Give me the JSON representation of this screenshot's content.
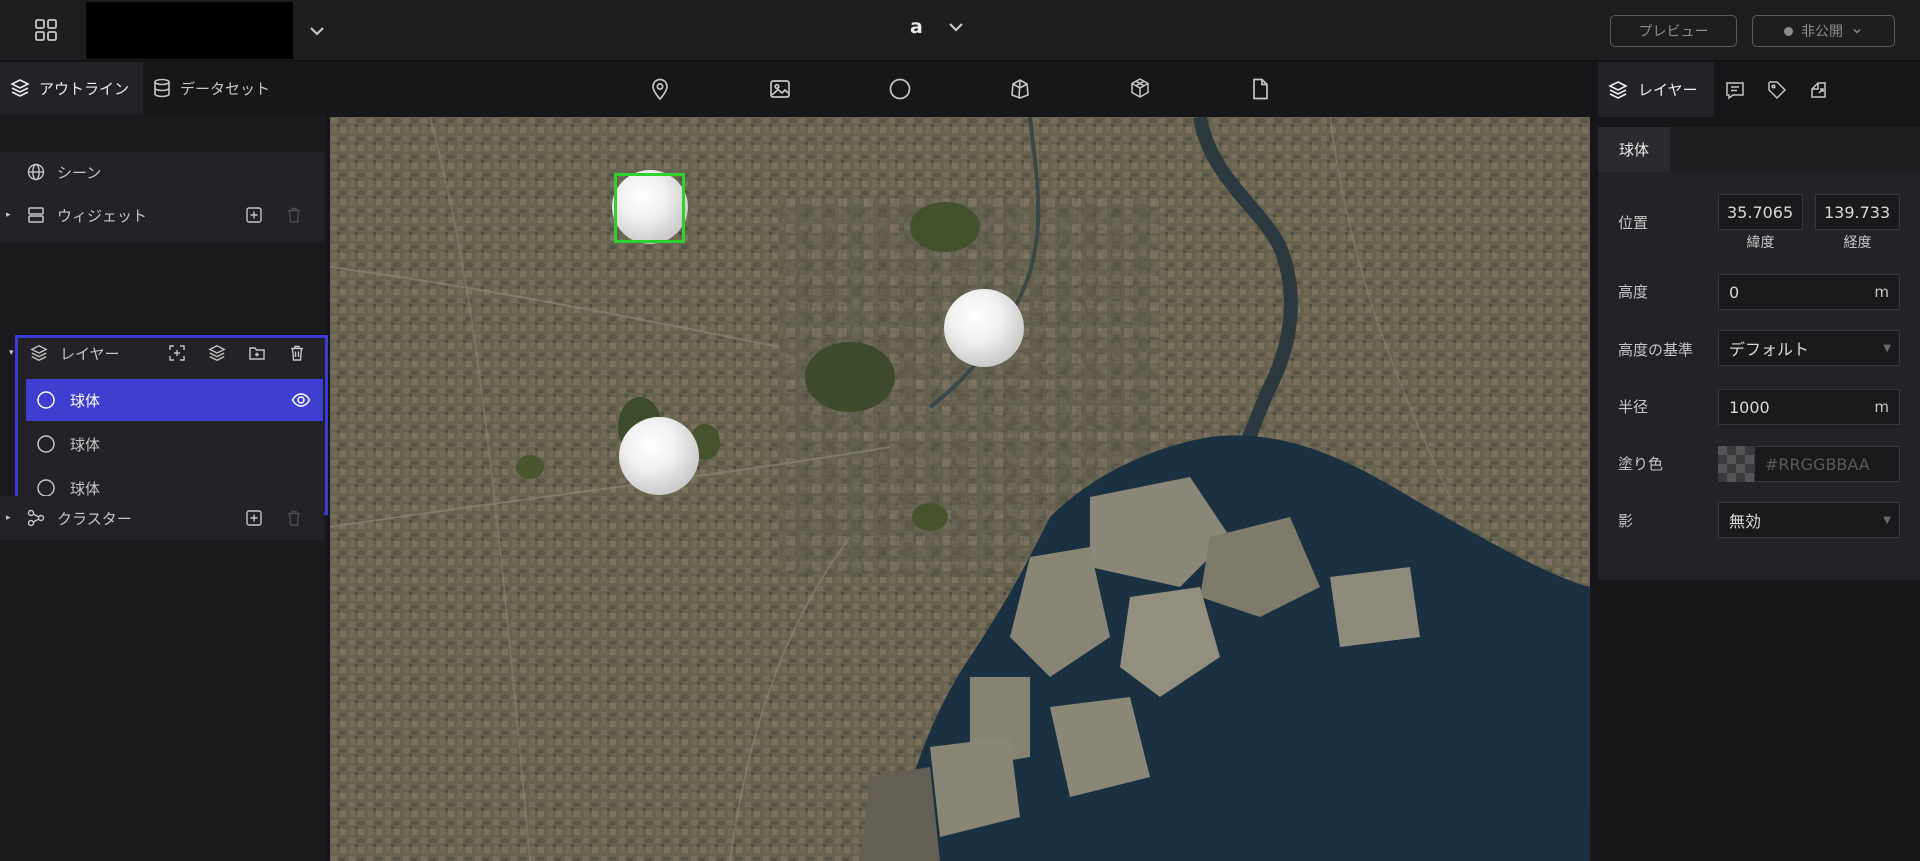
{
  "header": {
    "project_title": "a",
    "preview_label": "プレビュー",
    "publish_label": "非公開"
  },
  "left_panel": {
    "tabs": [
      {
        "label": "アウトライン",
        "icon": "layers-icon"
      },
      {
        "label": "データセット",
        "icon": "database-icon"
      }
    ],
    "scene_label": "シーン",
    "widget_label": "ウィジェット",
    "layers_label": "レイヤー",
    "layer_items": [
      {
        "label": "球体",
        "selected": true
      },
      {
        "label": "球体",
        "selected": false
      },
      {
        "label": "球体",
        "selected": false
      }
    ],
    "cluster_label": "クラスター"
  },
  "map_toolbar": {
    "tools": [
      "pin-icon",
      "image-icon",
      "circle-icon",
      "box-3d-icon",
      "model-icon",
      "file-icon"
    ]
  },
  "right_panel": {
    "tab_label": "レイヤー",
    "section_tab": "球体",
    "position_label": "位置",
    "latitude_value": "35.7065",
    "latitude_caption": "緯度",
    "longitude_value": "139.733",
    "longitude_caption": "経度",
    "height_label": "高度",
    "height_value": "0",
    "height_unit": "m",
    "height_ref_label": "高度の基準",
    "height_ref_value": "デフォルト",
    "radius_label": "半径",
    "radius_value": "1000",
    "radius_unit": "m",
    "fill_label": "塗り色",
    "fill_placeholder": "#RRGGBBAA",
    "shadow_label": "影",
    "shadow_value": "無効"
  },
  "colors": {
    "accent_selected": "#3e3ed1",
    "selection_box": "#2fd12f"
  }
}
